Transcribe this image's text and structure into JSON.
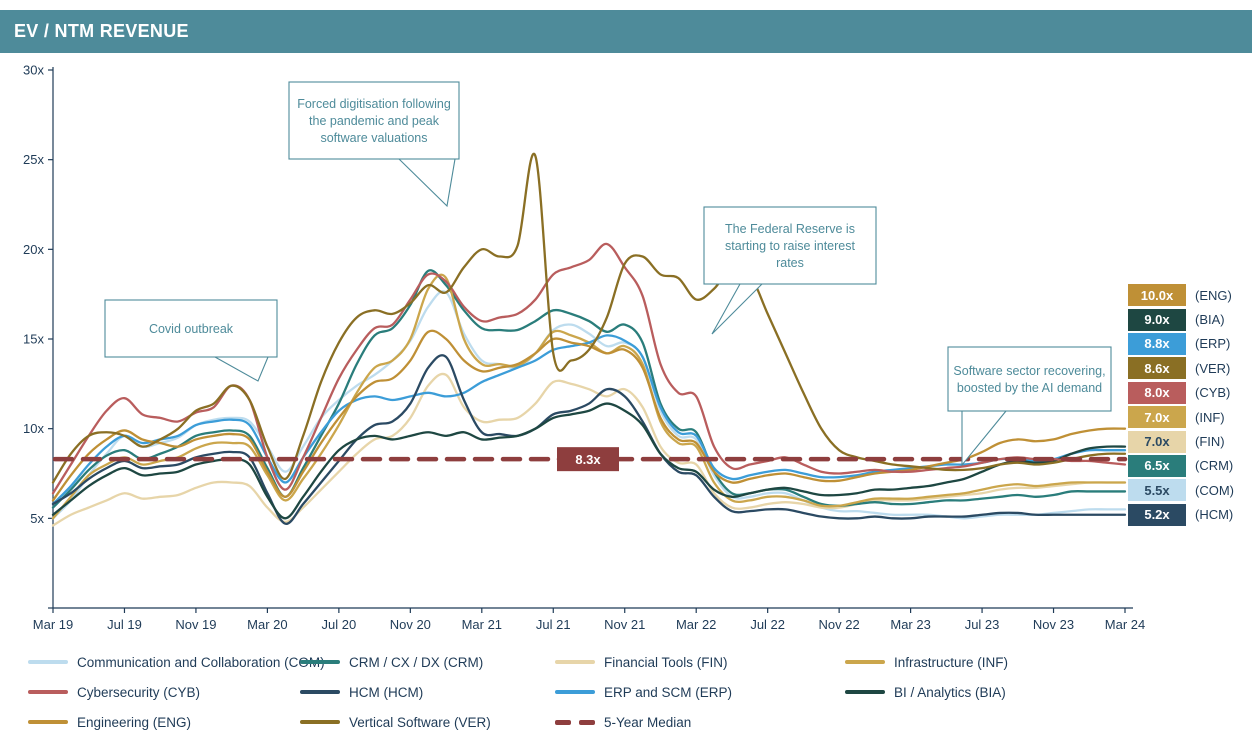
{
  "header": {
    "title": "EV / NTM REVENUE",
    "background": "#4e8b9a"
  },
  "chart_data": {
    "type": "line",
    "title": "EV / NTM REVENUE",
    "xlabel": "",
    "ylabel": "",
    "ylim": [
      0,
      30
    ],
    "ytick_labels": [
      "5x",
      "10x",
      "15x",
      "20x",
      "25x",
      "30x"
    ],
    "ytick_values": [
      5,
      10,
      15,
      20,
      25,
      30
    ],
    "grid": false,
    "legend_position": "bottom",
    "x": [
      "Mar 19",
      "Apr 19",
      "May 19",
      "Jun 19",
      "Jul 19",
      "Aug 19",
      "Sep 19",
      "Oct 19",
      "Nov 19",
      "Dec 19",
      "Jan 20",
      "Feb 20",
      "Mar 20",
      "Apr 20",
      "May 20",
      "Jun 20",
      "Jul 20",
      "Aug 20",
      "Sep 20",
      "Oct 20",
      "Nov 20",
      "Dec 20",
      "Jan 21",
      "Feb 21",
      "Mar 21",
      "Apr 21",
      "May 21",
      "Jun 21",
      "Jul 21",
      "Aug 21",
      "Sep 21",
      "Oct 21",
      "Nov 21",
      "Dec 21",
      "Jan 22",
      "Feb 22",
      "Mar 22",
      "Apr 22",
      "May 22",
      "Jun 22",
      "Jul 22",
      "Aug 22",
      "Sep 22",
      "Oct 22",
      "Nov 22",
      "Dec 22",
      "Jan 23",
      "Feb 23",
      "Mar 23",
      "Apr 23",
      "May 23",
      "Jun 23",
      "Jul 23",
      "Aug 23",
      "Sep 23",
      "Oct 23",
      "Nov 23",
      "Dec 23",
      "Jan 24",
      "Feb 24",
      "Mar 24"
    ],
    "xtick_labels": [
      "Mar 19",
      "Jul 19",
      "Nov 19",
      "Mar 20",
      "Jul 20",
      "Nov 20",
      "Mar 21",
      "Jul 21",
      "Nov 21",
      "Mar 22",
      "Jul 22",
      "Nov 22",
      "Mar 23",
      "Jul 23",
      "Nov 23",
      "Mar 24"
    ],
    "series": [
      {
        "name": "Communication and Collaboration (COM)",
        "code": "COM",
        "color": "#bddcee",
        "end_value": 5.5,
        "values": [
          5.0,
          6.0,
          7.4,
          8.6,
          9.6,
          9.0,
          9.2,
          9.5,
          10.2,
          10.5,
          10.6,
          10.4,
          9.0,
          7.6,
          9.0,
          10.6,
          11.6,
          12.4,
          13.0,
          13.8,
          14.9,
          16.8,
          17.6,
          15.3,
          13.8,
          13.6,
          13.4,
          14.2,
          15.5,
          15.8,
          15.3,
          14.6,
          14.8,
          14.0,
          11.0,
          9.6,
          9.4,
          7.4,
          6.2,
          6.2,
          6.4,
          6.4,
          6.0,
          5.6,
          5.4,
          5.4,
          5.3,
          5.2,
          5.2,
          5.2,
          5.1,
          5.0,
          5.1,
          5.2,
          5.2,
          5.2,
          5.3,
          5.4,
          5.5,
          5.5,
          5.5
        ]
      },
      {
        "name": "CRM / CX / DX (CRM)",
        "code": "CRM",
        "color": "#2a7d7b",
        "end_value": 6.5,
        "values": [
          5.6,
          6.6,
          7.7,
          8.5,
          8.8,
          8.3,
          8.6,
          9.0,
          9.6,
          9.8,
          9.9,
          9.6,
          7.8,
          6.2,
          7.8,
          9.6,
          11.4,
          13.6,
          15.2,
          15.6,
          16.9,
          18.8,
          18.0,
          16.6,
          15.6,
          15.5,
          15.5,
          16.0,
          16.6,
          16.4,
          16.0,
          15.4,
          15.8,
          14.8,
          11.4,
          10.0,
          9.8,
          7.6,
          6.4,
          6.4,
          6.6,
          6.6,
          6.2,
          5.8,
          5.7,
          5.8,
          5.9,
          5.8,
          5.8,
          5.9,
          6.0,
          6.0,
          6.1,
          6.2,
          6.3,
          6.2,
          6.3,
          6.5,
          6.5,
          6.5,
          6.5
        ]
      },
      {
        "name": "Financial Tools (FIN)",
        "code": "FIN",
        "color": "#e7d5a9",
        "end_value": 7.0,
        "values": [
          4.6,
          5.2,
          5.6,
          6.0,
          6.4,
          6.1,
          6.2,
          6.3,
          6.7,
          7.0,
          7.0,
          6.8,
          5.6,
          4.8,
          5.6,
          6.6,
          7.6,
          8.6,
          9.4,
          9.6,
          10.6,
          12.4,
          13.0,
          11.2,
          10.4,
          10.5,
          10.6,
          11.4,
          12.6,
          12.5,
          12.2,
          11.8,
          12.2,
          11.2,
          9.0,
          8.1,
          8.0,
          6.4,
          5.6,
          5.6,
          5.8,
          5.9,
          5.8,
          5.6,
          5.6,
          5.8,
          6.0,
          6.0,
          6.0,
          6.1,
          6.2,
          6.3,
          6.4,
          6.6,
          6.7,
          6.7,
          6.8,
          6.9,
          7.0,
          7.0,
          7.0
        ]
      },
      {
        "name": "Infrastructure (INF)",
        "code": "INF",
        "color": "#cba64c",
        "end_value": 7.0,
        "values": [
          5.0,
          6.2,
          7.4,
          8.0,
          8.4,
          8.0,
          8.2,
          8.4,
          8.9,
          9.2,
          9.2,
          9.0,
          7.4,
          6.0,
          7.2,
          8.6,
          10.2,
          12.0,
          13.4,
          13.8,
          15.0,
          17.8,
          18.4,
          15.0,
          13.6,
          13.6,
          13.5,
          14.2,
          15.4,
          15.2,
          14.8,
          14.2,
          14.6,
          13.6,
          10.4,
          9.2,
          9.0,
          7.0,
          6.0,
          6.0,
          6.2,
          6.2,
          6.0,
          5.7,
          5.7,
          5.9,
          6.1,
          6.1,
          6.1,
          6.2,
          6.3,
          6.4,
          6.6,
          6.8,
          6.9,
          6.8,
          6.9,
          7.0,
          7.0,
          7.0,
          7.0
        ]
      },
      {
        "name": "Cybersecurity (CYB)",
        "code": "CYB",
        "color": "#b95d5d",
        "end_value": 8.0,
        "values": [
          6.4,
          8.0,
          9.6,
          11.0,
          11.7,
          10.8,
          10.6,
          10.4,
          10.9,
          11.2,
          12.4,
          11.6,
          8.4,
          6.6,
          8.4,
          10.6,
          12.8,
          14.4,
          15.6,
          15.8,
          17.2,
          18.6,
          18.2,
          16.8,
          16.0,
          16.2,
          16.4,
          17.2,
          18.6,
          19.0,
          19.4,
          20.3,
          19.0,
          17.4,
          13.6,
          12.0,
          11.8,
          9.0,
          7.8,
          8.0,
          8.2,
          8.4,
          8.0,
          7.6,
          7.5,
          7.6,
          7.7,
          7.6,
          7.6,
          7.7,
          7.8,
          7.9,
          8.1,
          8.3,
          8.4,
          8.3,
          8.3,
          8.2,
          8.2,
          8.1,
          8.0
        ]
      },
      {
        "name": "HCM (HCM)",
        "code": "HCM",
        "color": "#2b4a63",
        "end_value": 5.2,
        "values": [
          5.8,
          6.4,
          7.2,
          7.8,
          8.2,
          7.8,
          7.9,
          8.0,
          8.4,
          8.6,
          8.7,
          8.4,
          6.4,
          4.7,
          5.8,
          7.0,
          8.2,
          9.4,
          10.2,
          10.4,
          11.4,
          13.4,
          14.0,
          11.6,
          9.8,
          9.7,
          9.6,
          10.0,
          10.8,
          11.0,
          11.4,
          12.2,
          11.8,
          10.4,
          8.6,
          7.6,
          7.4,
          6.2,
          5.4,
          5.4,
          5.5,
          5.5,
          5.3,
          5.1,
          5.0,
          5.0,
          5.1,
          5.0,
          5.0,
          5.1,
          5.1,
          5.1,
          5.2,
          5.3,
          5.3,
          5.2,
          5.2,
          5.2,
          5.2,
          5.2,
          5.2
        ]
      },
      {
        "name": "ERP and SCM (ERP)",
        "code": "ERP",
        "color": "#3c9dd8",
        "end_value": 8.8,
        "values": [
          5.8,
          6.8,
          8.0,
          9.0,
          9.6,
          9.2,
          9.4,
          9.6,
          10.2,
          10.4,
          10.5,
          10.2,
          8.4,
          7.0,
          8.4,
          9.8,
          11.0,
          11.6,
          11.8,
          11.6,
          11.8,
          12.0,
          11.8,
          12.0,
          12.6,
          13.0,
          13.4,
          13.8,
          14.4,
          14.6,
          14.8,
          15.2,
          14.9,
          14.0,
          11.2,
          9.8,
          9.6,
          7.8,
          7.2,
          7.4,
          7.6,
          7.7,
          7.5,
          7.3,
          7.3,
          7.4,
          7.6,
          7.7,
          7.8,
          7.9,
          8.0,
          8.0,
          8.1,
          8.3,
          8.3,
          8.2,
          8.3,
          8.6,
          8.8,
          8.8,
          8.8
        ]
      },
      {
        "name": "BI / Analytics (BIA)",
        "code": "BIA",
        "color": "#1e4742",
        "end_value": 9.0,
        "values": [
          5.2,
          6.0,
          6.8,
          7.4,
          7.8,
          7.4,
          7.5,
          7.6,
          8.0,
          8.2,
          8.3,
          8.0,
          6.2,
          5.0,
          6.2,
          7.6,
          8.8,
          9.4,
          9.6,
          9.4,
          9.6,
          9.8,
          9.6,
          9.8,
          9.4,
          9.5,
          9.6,
          10.0,
          10.6,
          10.8,
          11.0,
          11.4,
          11.0,
          10.2,
          8.6,
          7.8,
          7.6,
          6.6,
          6.2,
          6.4,
          6.6,
          6.7,
          6.5,
          6.3,
          6.3,
          6.4,
          6.6,
          6.6,
          6.7,
          6.8,
          7.0,
          7.2,
          7.6,
          8.0,
          8.2,
          8.1,
          8.2,
          8.6,
          8.9,
          9.0,
          9.0
        ]
      },
      {
        "name": "Engineering (ENG)",
        "code": "ENG",
        "color": "#bf9036",
        "end_value": 10.0,
        "values": [
          6.0,
          7.4,
          8.6,
          9.4,
          9.9,
          9.4,
          9.2,
          9.0,
          9.4,
          9.6,
          9.7,
          9.4,
          7.6,
          6.2,
          7.6,
          9.2,
          10.6,
          11.8,
          12.6,
          12.8,
          13.8,
          15.4,
          15.0,
          13.8,
          13.2,
          13.4,
          13.6,
          14.2,
          15.0,
          14.8,
          14.6,
          14.2,
          14.4,
          13.4,
          10.6,
          9.4,
          9.2,
          7.6,
          7.0,
          7.2,
          7.4,
          7.5,
          7.3,
          7.1,
          7.1,
          7.3,
          7.5,
          7.6,
          7.7,
          7.9,
          8.1,
          8.3,
          8.7,
          9.2,
          9.4,
          9.3,
          9.4,
          9.7,
          9.9,
          10.0,
          10.0
        ]
      },
      {
        "name": "Vertical Software (VER)",
        "code": "VER",
        "color": "#8a6f24",
        "end_value": 8.6,
        "values": [
          7.0,
          8.6,
          9.6,
          9.8,
          9.6,
          9.0,
          9.4,
          10.0,
          11.0,
          11.4,
          12.4,
          11.6,
          9.0,
          7.2,
          9.6,
          12.6,
          14.8,
          16.2,
          16.6,
          16.4,
          17.0,
          18.0,
          17.6,
          19.0,
          20.0,
          19.6,
          20.2,
          25.2,
          14.2,
          13.8,
          14.4,
          16.2,
          19.2,
          19.6,
          18.6,
          18.4,
          17.2,
          17.8,
          19.0,
          18.6,
          16.4,
          14.2,
          12.0,
          10.0,
          8.8,
          8.4,
          8.2,
          8.0,
          7.9,
          7.8,
          7.7,
          7.7,
          7.8,
          8.0,
          8.1,
          8.0,
          8.1,
          8.3,
          8.5,
          8.6,
          8.6
        ]
      }
    ],
    "median": {
      "label": "8.3x",
      "value": 8.3,
      "color": "#8e3e3e",
      "legend_label": "5-Year Median"
    },
    "annotations": [
      {
        "id": "covid",
        "lines": [
          "Covid outbreak"
        ]
      },
      {
        "id": "forced-digitisation",
        "lines": [
          "Forced digitisation following",
          "the pandemic and peak",
          "software valuations"
        ]
      },
      {
        "id": "fed-rates",
        "lines": [
          "The Federal Reserve is",
          "starting to raise interest",
          "rates"
        ]
      },
      {
        "id": "ai-recovery",
        "lines": [
          "Software sector recovering,",
          "boosted by the AI demand"
        ]
      }
    ]
  },
  "right_labels": [
    {
      "value": "10.0x",
      "code": "(ENG)",
      "color": "#bf9036"
    },
    {
      "value": "9.0x",
      "code": "(BIA)",
      "color": "#1e4742"
    },
    {
      "value": "8.8x",
      "code": "(ERP)",
      "color": "#3c9dd8"
    },
    {
      "value": "8.6x",
      "code": "(VER)",
      "color": "#8a6f24"
    },
    {
      "value": "8.0x",
      "code": "(CYB)",
      "color": "#b95d5d"
    },
    {
      "value": "7.0x",
      "code": "(INF)",
      "color": "#cba64c"
    },
    {
      "value": "7.0x",
      "code": "(FIN)",
      "color": "#e7d5a9"
    },
    {
      "value": "6.5x",
      "code": "(CRM)",
      "color": "#2a7d7b"
    },
    {
      "value": "5.5x",
      "code": "(COM)",
      "color": "#bddcee"
    },
    {
      "value": "5.2x",
      "code": "(HCM)",
      "color": "#2b4a63"
    }
  ],
  "legend": [
    {
      "label": "Communication and Collaboration (COM)",
      "color": "#bddcee",
      "dashed": false,
      "col": 0,
      "row": 0
    },
    {
      "label": "CRM / CX / DX (CRM)",
      "color": "#2a7d7b",
      "dashed": false,
      "col": 1,
      "row": 0
    },
    {
      "label": "Financial Tools (FIN)",
      "color": "#e7d5a9",
      "dashed": false,
      "col": 2,
      "row": 0
    },
    {
      "label": "Infrastructure (INF)",
      "color": "#cba64c",
      "dashed": false,
      "col": 3,
      "row": 0
    },
    {
      "label": "Cybersecurity (CYB)",
      "color": "#b95d5d",
      "dashed": false,
      "col": 0,
      "row": 1
    },
    {
      "label": "HCM (HCM)",
      "color": "#2b4a63",
      "dashed": false,
      "col": 1,
      "row": 1
    },
    {
      "label": "ERP and SCM (ERP)",
      "color": "#3c9dd8",
      "dashed": false,
      "col": 2,
      "row": 1
    },
    {
      "label": "BI / Analytics (BIA)",
      "color": "#1e4742",
      "dashed": false,
      "col": 3,
      "row": 1
    },
    {
      "label": "Engineering (ENG)",
      "color": "#bf9036",
      "dashed": false,
      "col": 0,
      "row": 2
    },
    {
      "label": "Vertical Software (VER)",
      "color": "#8a6f24",
      "dashed": false,
      "col": 1,
      "row": 2
    },
    {
      "label": "5-Year Median",
      "color": "#8e3e3e",
      "dashed": true,
      "col": 2,
      "row": 2
    }
  ]
}
